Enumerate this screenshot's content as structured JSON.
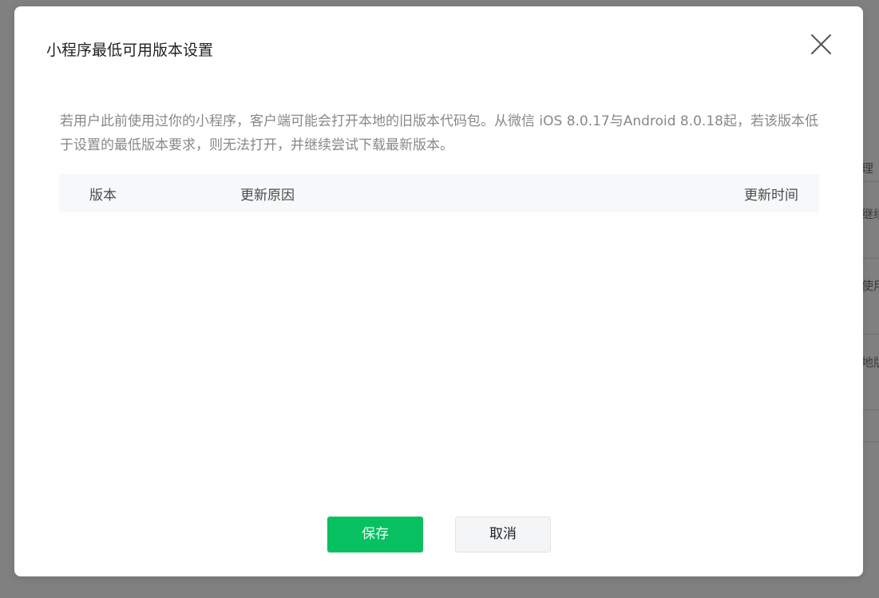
{
  "dialog": {
    "title": "小程序最低可用版本设置",
    "description": "若用户此前使用过你的小程序，客户端可能会打开本地的旧版本代码包。从微信 iOS 8.0.17与Android 8.0.18起，若该版本低于设置的最低版本要求，则无法打开，并继续尝试下载最新版本。",
    "table": {
      "columns": [
        "版本",
        "更新原因",
        "更新时间"
      ],
      "rows": []
    },
    "buttons": {
      "save": "保存",
      "cancel": "取消"
    },
    "close_icon": "close-icon"
  },
  "background": {
    "fragments": [
      "理",
      "继续",
      "使用",
      "地版"
    ]
  },
  "colors": {
    "accent": "#07c160",
    "overlay": "#7f7f7f"
  }
}
